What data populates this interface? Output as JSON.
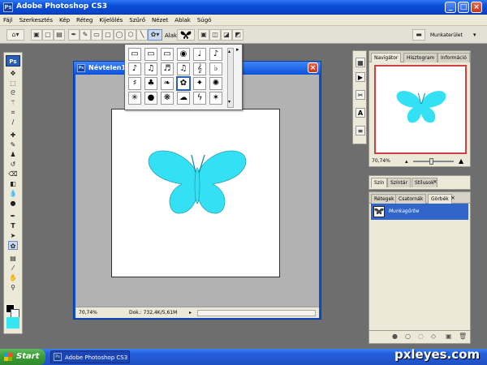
{
  "app": {
    "title": "Adobe Photoshop CS3",
    "logo_text": "Ps"
  },
  "window_buttons": {
    "min": "_",
    "max": "□",
    "close": "×"
  },
  "menu": [
    "Fájl",
    "Szerkesztés",
    "Kép",
    "Réteg",
    "Kijelölés",
    "Szűrő",
    "Nézet",
    "Ablak",
    "Súgó"
  ],
  "options": {
    "shape_label": "Alak:",
    "workspace_label": "Munkaterület"
  },
  "document": {
    "title": "Névtelen1 @",
    "zoom": "70,74%",
    "status": "Dok.: 732,4K/5,61M"
  },
  "shape_picker": {
    "rows": [
      [
        "▭",
        "▭",
        "▭",
        "◉",
        "♩",
        "♪"
      ],
      [
        "♪",
        "♫",
        "♬",
        "♫",
        "𝄞",
        "♭"
      ],
      [
        "♯",
        "♣",
        "❧",
        "✿",
        "✦",
        "✺"
      ],
      [
        "✳",
        "●",
        "❋",
        "☁",
        "ϟ",
        "✶"
      ]
    ],
    "selected": [
      2,
      3
    ]
  },
  "nav_panel": {
    "tabs": [
      "Navigátor",
      "Hisztogram",
      "Információ"
    ],
    "zoom": "70,74%"
  },
  "swatch_panel": {
    "tabs": [
      "Szín",
      "Színtár",
      "Stílusok"
    ]
  },
  "layers_panel": {
    "tabs": [
      "Rétegek",
      "Csatornák",
      "Görbék"
    ],
    "layer_name": "Munkagörbe"
  },
  "butterfly_color": "#34e0f4",
  "taskbar": {
    "start": "Start",
    "task": "Adobe Photoshop CS3"
  },
  "watermark": "pxleyes.com"
}
